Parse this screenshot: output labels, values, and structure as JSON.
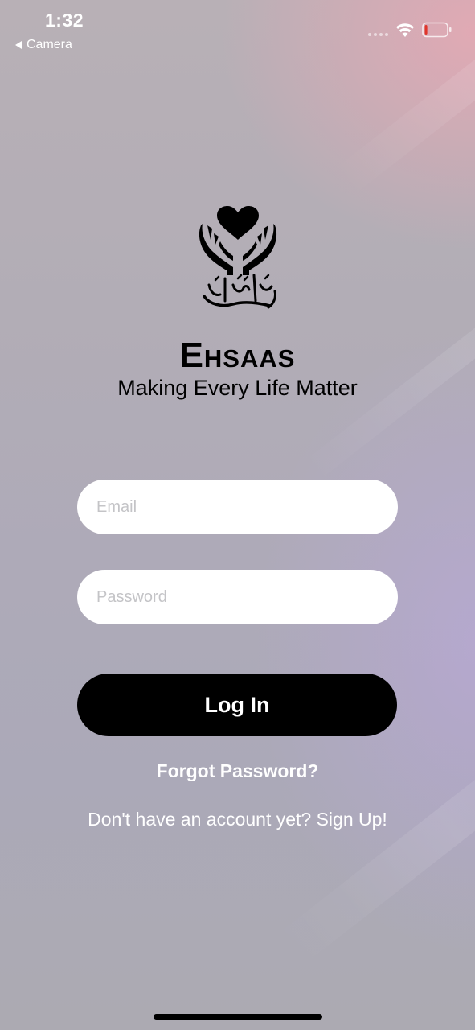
{
  "status_bar": {
    "time": "1:32",
    "back_label": "Camera",
    "wifi_icon": "wifi-icon",
    "battery_icon": "battery-icon",
    "battery_level": 0.12,
    "battery_color": "#e0352b"
  },
  "branding": {
    "logo_icon": "heart-in-hands-calligraphy-logo",
    "app_name": "Ehsaas",
    "tagline": "Making Every Life Matter"
  },
  "form": {
    "email_placeholder": "Email",
    "email_value": "",
    "password_placeholder": "Password",
    "password_value": "",
    "login_label": "Log In",
    "forgot_label": "Forgot Password?",
    "signup_label": "Don't have an account yet? Sign Up!"
  },
  "colors": {
    "button_background": "#000000",
    "button_text": "#ffffff",
    "field_background": "#ffffff",
    "link_text": "#ffffff"
  }
}
